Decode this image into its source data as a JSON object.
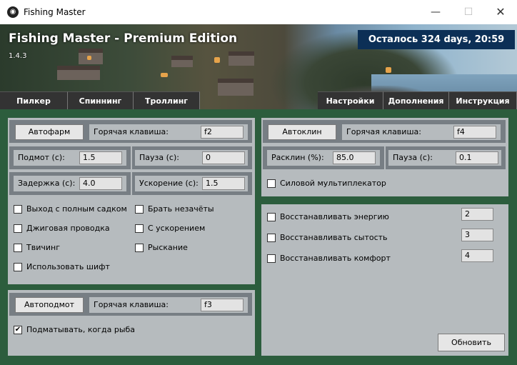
{
  "window": {
    "title": "Fishing Master",
    "icon": "fishing-globe-icon",
    "minimize": "—",
    "maximize": "☐",
    "close": "✕"
  },
  "banner": {
    "title": "Fishing Master - Premium Edition",
    "version": "1.4.3",
    "timer": "Осталось 324 days, 20:59"
  },
  "tabs_left": [
    "Пилкер",
    "Спиннинг",
    "Троллинг"
  ],
  "tabs_right": [
    "Настройки",
    "Дополнения",
    "Инструкция"
  ],
  "autofarm": {
    "button": "Автофарм",
    "hotkey_label": "Горячая клавиша:",
    "hotkey_value": "f2",
    "podmot_label": "Подмот (с):",
    "podmot_value": "1.5",
    "pause_label": "Пауза (с):",
    "pause_value": "0",
    "delay_label": "Задержка (с):",
    "delay_value": "4.0",
    "accel_label": "Ускорение (с):",
    "accel_value": "1.5",
    "options": [
      {
        "label": "Выход с полным садком",
        "checked": false
      },
      {
        "label": "Брать незачёты",
        "checked": false
      },
      {
        "label": "Джиговая проводка",
        "checked": false
      },
      {
        "label": "С ускорением",
        "checked": false
      },
      {
        "label": "Твичинг",
        "checked": false
      },
      {
        "label": "Рыскание",
        "checked": false
      },
      {
        "label": "Использовать шифт",
        "checked": false
      }
    ]
  },
  "autopodmot": {
    "button": "Автоподмот",
    "hotkey_label": "Горячая клавиша:",
    "hotkey_value": "f3",
    "option_label": "Подматывать, когда рыба",
    "check_mark": "✔"
  },
  "autoclick": {
    "button": "Автоклин",
    "hotkey_label": "Горячая клавиша:",
    "hotkey_value": "f4",
    "rasklin_label": "Расклин (%):",
    "rasklin_value": "85.0",
    "pause_label": "Пауза (с):",
    "pause_value": "0.1",
    "multiplier_label": "Силовой мультиплекатор"
  },
  "restore": {
    "items": [
      {
        "label": "Восстанавливать энергию",
        "value": "2"
      },
      {
        "label": "Восстанавливать сытость",
        "value": "3"
      },
      {
        "label": "Восстанавливать комфорт",
        "value": "4"
      }
    ],
    "update_button": "Обновить"
  },
  "colors": {
    "main_bg": "#2c5d3d",
    "panel_bg": "#b6bbbe",
    "group_bg": "#777e84",
    "timer_bg": "#0c2f56",
    "tab_bg": "#333333"
  }
}
